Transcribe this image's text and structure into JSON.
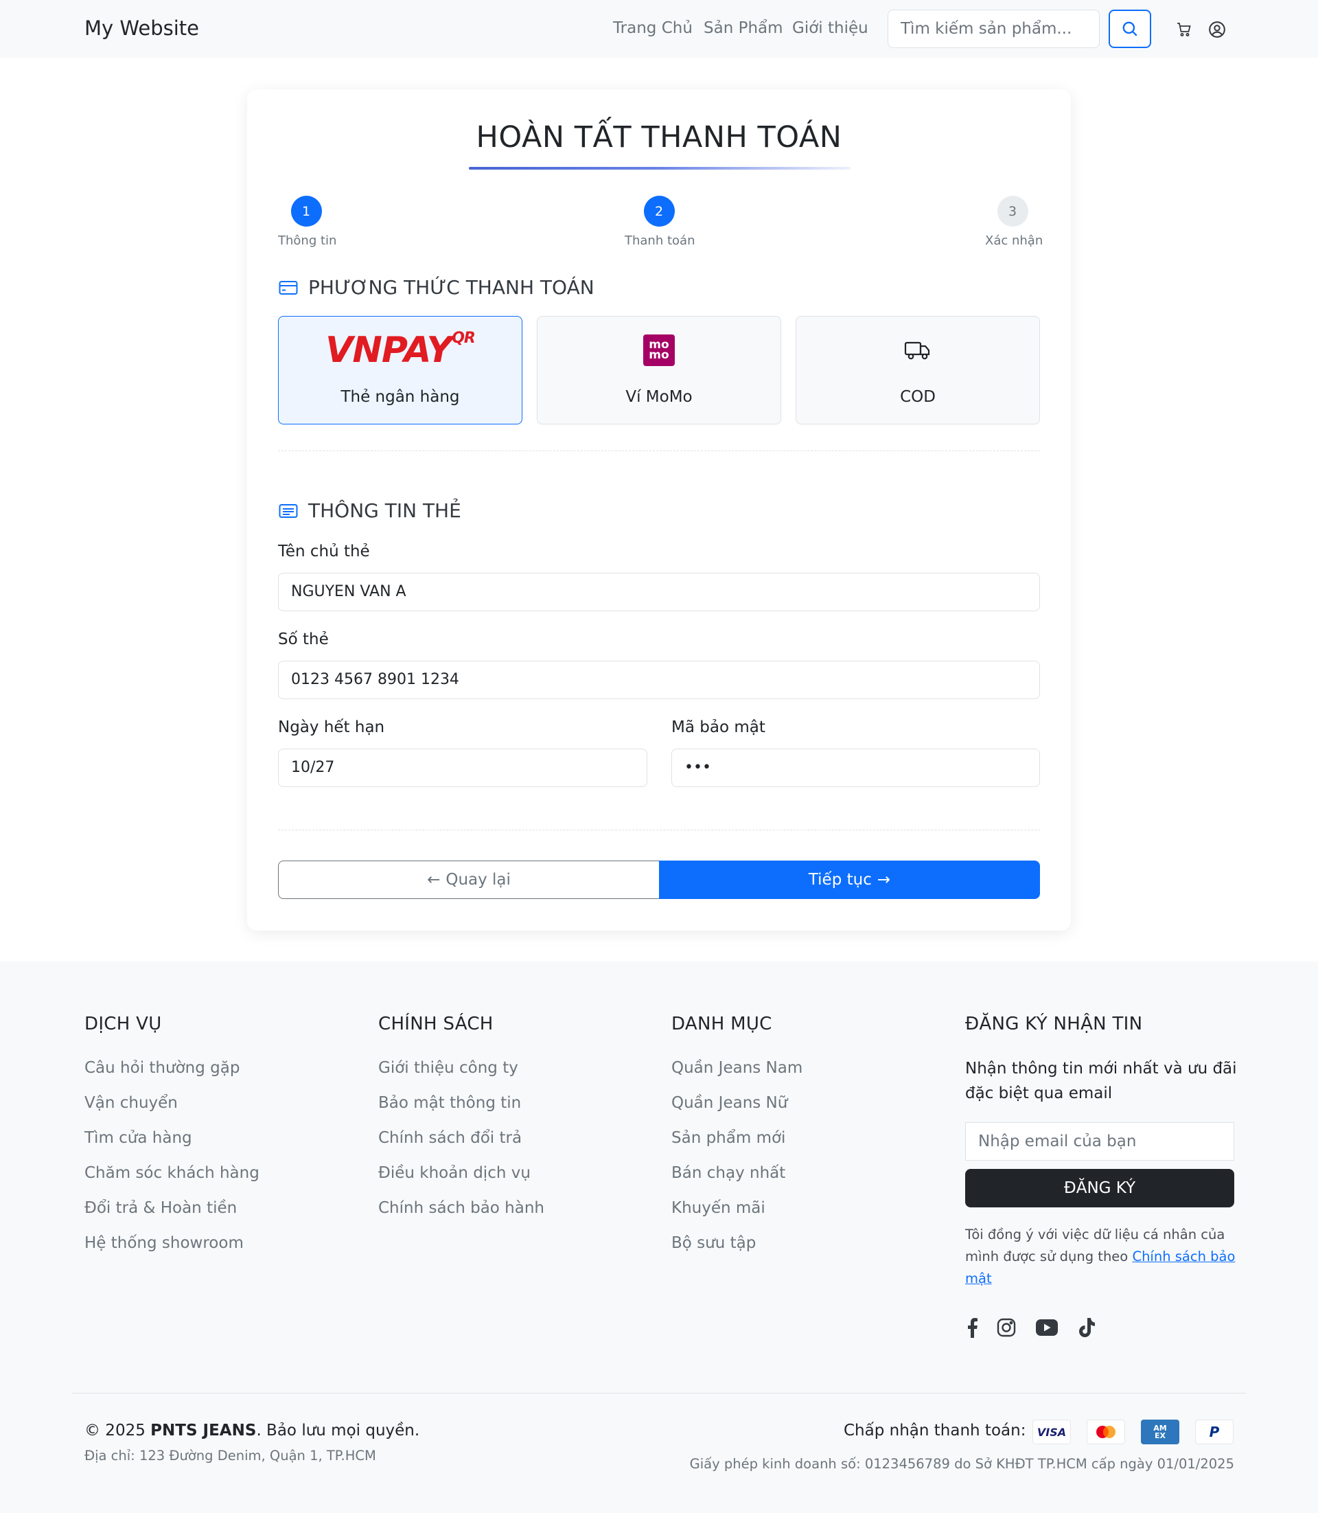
{
  "header": {
    "brand": "My Website",
    "nav": [
      "Trang Chủ",
      "Sản Phẩm",
      "Giới thiệu"
    ],
    "search_placeholder": "Tìm kiếm sản phẩm...",
    "icons": [
      "search-icon",
      "cart-icon",
      "user-icon"
    ]
  },
  "checkout": {
    "title": "HOÀN TẤT THANH TOÁN",
    "steps": [
      {
        "number": "1",
        "label": "Thông tin",
        "state": "done"
      },
      {
        "number": "2",
        "label": "Thanh toán",
        "state": "current"
      },
      {
        "number": "3",
        "label": "Xác nhận",
        "state": "pending"
      }
    ],
    "payment_section_title": "PHƯƠNG THỨC THANH TOÁN",
    "methods": [
      {
        "label": "Thẻ ngân hàng",
        "logo_text": "VNPAY",
        "logo_sup": "QR",
        "selected": true
      },
      {
        "label": "Ví MoMo",
        "logo_text": "mo mo",
        "selected": false
      },
      {
        "label": "COD",
        "logo_icon": "truck-icon",
        "selected": false
      }
    ],
    "card_section_title": "THÔNG TIN THẺ",
    "fields": {
      "holder": {
        "label": "Tên chủ thẻ",
        "value": "NGUYEN VAN A"
      },
      "number": {
        "label": "Số thẻ",
        "value": "0123 4567 8901 1234"
      },
      "expiry": {
        "label": "Ngày hết hạn",
        "value": "10/27"
      },
      "cvv": {
        "label": "Mã bảo mật",
        "value": "•••"
      }
    },
    "back_label": "Quay lại",
    "next_label": "Tiếp tục"
  },
  "footer": {
    "columns": [
      {
        "heading": "DỊCH VỤ",
        "links": [
          "Câu hỏi thường gặp",
          "Vận chuyển",
          "Tìm cửa hàng",
          "Chăm sóc khách hàng",
          "Đổi trả & Hoàn tiền",
          "Hệ thống showroom"
        ]
      },
      {
        "heading": "CHÍNH SÁCH",
        "links": [
          "Giới thiệu công ty",
          "Bảo mật thông tin",
          "Chính sách đổi trả",
          "Điều khoản dịch vụ",
          "Chính sách bảo hành"
        ]
      },
      {
        "heading": "DANH MỤC",
        "links": [
          "Quần Jeans Nam",
          "Quần Jeans Nữ",
          "Sản phẩm mới",
          "Bán chạy nhất",
          "Khuyến mãi",
          "Bộ sưu tập"
        ]
      }
    ],
    "newsletter": {
      "heading": "ĐĂNG KÝ NHẬN TIN",
      "text_line1": "Nhận thông tin mới nhất và ưu đãi",
      "text_line2": "đặc biệt qua email",
      "email_placeholder": "Nhập email của bạn",
      "button": "ĐĂNG KÝ",
      "consent_text": "Tôi đồng ý với việc dữ liệu cá nhân của mình được sử dụng theo",
      "consent_link": "Chính sách bảo mật"
    },
    "social_icons": [
      "facebook-icon",
      "instagram-icon",
      "youtube-icon",
      "tiktok-icon"
    ],
    "copyright_prefix": "© 2025",
    "copyright_brand": "PNTS JEANS",
    "copyright_suffix": ". Bảo lưu mọi quyền.",
    "address": "Địa chỉ: 123 Đường Denim, Quận 1, TP.HCM",
    "payment_accept": "Chấp nhận thanh toán:",
    "payment_cards": [
      {
        "name": "visa-icon",
        "text": "VISA",
        "color": "#1a1f71"
      },
      {
        "name": "mastercard-icon",
        "text": "",
        "color": "#eb001b"
      },
      {
        "name": "amex-icon",
        "text": "AM EX",
        "color": "#2e77bc"
      },
      {
        "name": "paypal-icon",
        "text": "P",
        "color": "#003087"
      }
    ],
    "license": "Giấy phép kinh doanh số: 0123456789 do Sở KHĐT TP.HCM cấp ngày 01/01/2025"
  }
}
